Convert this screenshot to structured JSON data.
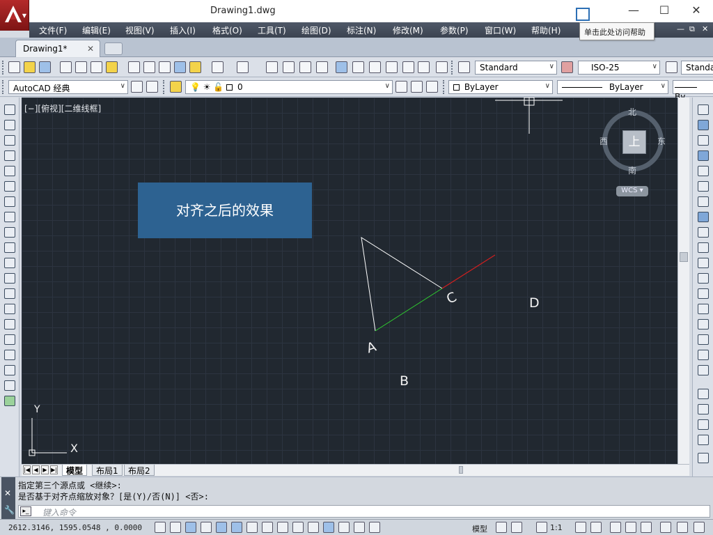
{
  "window": {
    "title": "Drawing1.dwg",
    "minimize": "—",
    "maximize": "☐",
    "close": "✕",
    "help_tooltip": "单击此处访问帮助"
  },
  "menu": [
    "文件(F)",
    "编辑(E)",
    "视图(V)",
    "插入(I)",
    "格式(O)",
    "工具(T)",
    "绘图(D)",
    "标注(N)",
    "修改(M)",
    "参数(P)",
    "窗口(W)",
    "帮助(H)"
  ],
  "mdi_controls": [
    "—",
    "⧉",
    "✕"
  ],
  "tabs": {
    "active": "Drawing1*",
    "close": "✕"
  },
  "toolbar": {
    "text_style": "Standard",
    "dim_style": "ISO-25",
    "table_style": "Standa",
    "workspace": "AutoCAD 经典",
    "layer": "0",
    "color": "ByLayer",
    "linetype": "ByLayer",
    "lineweight": "By"
  },
  "viewport": {
    "label": "[−][俯视][二维线框]",
    "callout": "对齐之后的效果",
    "points": {
      "a": "A",
      "b": "B",
      "c": "C",
      "d": "D"
    },
    "axis_x": "X",
    "axis_y": "Y"
  },
  "viewcube": {
    "face": "上",
    "north": "北",
    "south": "南",
    "east": "东",
    "west": "西",
    "wcs": "WCS ▾"
  },
  "layout_tabs": [
    "模型",
    "布局1",
    "布局2"
  ],
  "command": {
    "line1": "指定第三个源点或 <继续>:",
    "line2": "是否基于对齐点缩放对象？[是(Y)/否(N)] <否>:",
    "placeholder": "键入命令"
  },
  "status": {
    "coords": "2612.3146,  1595.0548 , 0.0000",
    "model": "模型",
    "scale": "1:1"
  }
}
